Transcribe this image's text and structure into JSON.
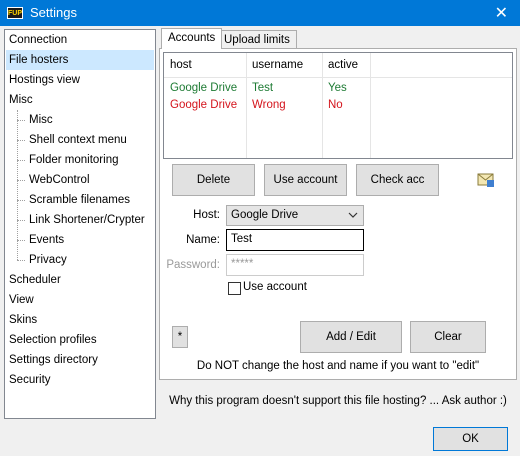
{
  "window": {
    "app_icon_text": "FUP",
    "title": "Settings",
    "close_glyph": "✕"
  },
  "sidebar": {
    "items": [
      {
        "label": "Connection"
      },
      {
        "label": "File hosters",
        "selected": true
      },
      {
        "label": "Hostings view"
      },
      {
        "label": "Misc"
      },
      {
        "label": "Misc"
      },
      {
        "label": "Shell context menu"
      },
      {
        "label": "Folder monitoring"
      },
      {
        "label": "WebControl"
      },
      {
        "label": "Scramble filenames"
      },
      {
        "label": "Link Shortener/Crypter"
      },
      {
        "label": "Events"
      },
      {
        "label": "Privacy"
      },
      {
        "label": "Scheduler"
      },
      {
        "label": "View"
      },
      {
        "label": "Skins"
      },
      {
        "label": "Selection profiles"
      },
      {
        "label": "Settings directory"
      },
      {
        "label": "Security"
      }
    ]
  },
  "tabs": [
    {
      "label": "Accounts",
      "active": true
    },
    {
      "label": "Upload limits",
      "active": false
    }
  ],
  "accounts_table": {
    "columns": [
      "host",
      "username",
      "active"
    ],
    "rows": [
      {
        "host": "Google Drive",
        "username": "Test",
        "active": "Yes",
        "color": "#1e7b34"
      },
      {
        "host": "Google Drive",
        "username": "Wrong",
        "active": "No",
        "color": "#d4141c"
      }
    ]
  },
  "actions": {
    "delete": "Delete",
    "use_account": "Use account",
    "check_acc": "Check acc",
    "mail_icon": "mail-warning-icon"
  },
  "form": {
    "host_label": "Host:",
    "host_value": "Google Drive",
    "name_label": "Name:",
    "name_value": "Test",
    "password_label": "Password:",
    "password_value": "*****",
    "use_account_checkbox_label": "Use account",
    "use_account_checked": false
  },
  "bottom_buttons": {
    "star": "*",
    "add_edit": "Add / Edit",
    "clear": "Clear"
  },
  "hint_text": "Do NOT change the host and name if you want to \"edit\"",
  "support_text": "Why this program doesn't support this file hosting? ... Ask author :)",
  "ok_label": "OK",
  "colors": {
    "titlebar": "#0078d7",
    "selection": "#cce8ff",
    "active_green": "#1e7b34",
    "inactive_red": "#d4141c"
  }
}
